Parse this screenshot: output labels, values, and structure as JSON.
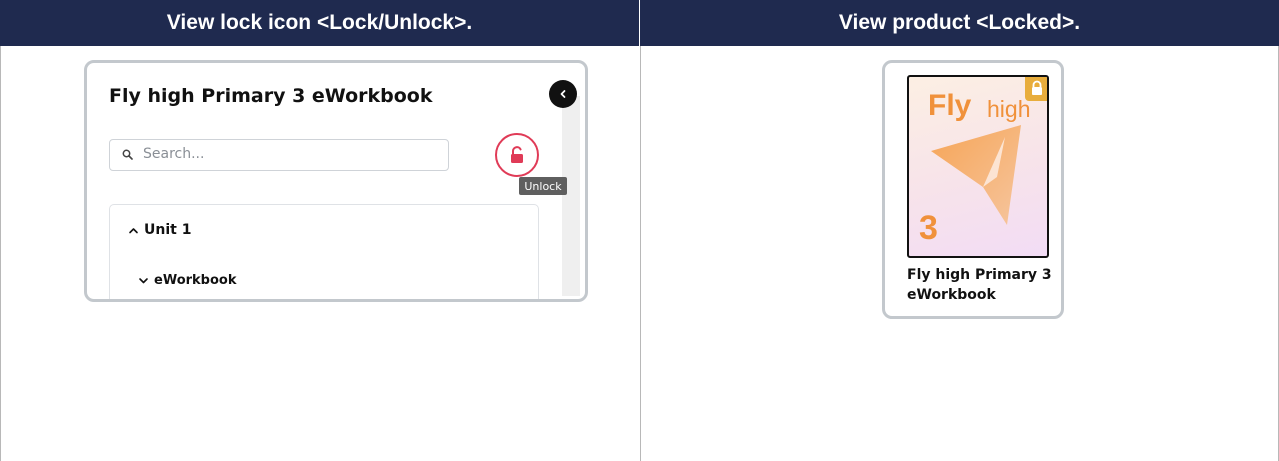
{
  "headers": {
    "left": "View lock icon <Lock/Unlock>.",
    "right": "View product <Locked>."
  },
  "left_panel": {
    "title": "Fly high Primary 3 eWorkbook",
    "search": {
      "placeholder": "Search..."
    },
    "lock_button": {
      "icon": "unlock-icon",
      "color": "#e03b57"
    },
    "tooltip": "Unlock",
    "tree": {
      "unit_label": "Unit 1",
      "sub_label": "eWorkbook"
    }
  },
  "product_card": {
    "cover_brand": "Fly",
    "cover_brand_suffix": "high",
    "cover_number": "3",
    "status_icon": "lock-icon",
    "title": "Fly high Primary 3 eWorkbook"
  },
  "colors": {
    "header_bg": "#1f2a4f",
    "accent_red": "#e03b57",
    "accent_orange": "#f0913b",
    "lock_badge": "#e8ad3c"
  }
}
